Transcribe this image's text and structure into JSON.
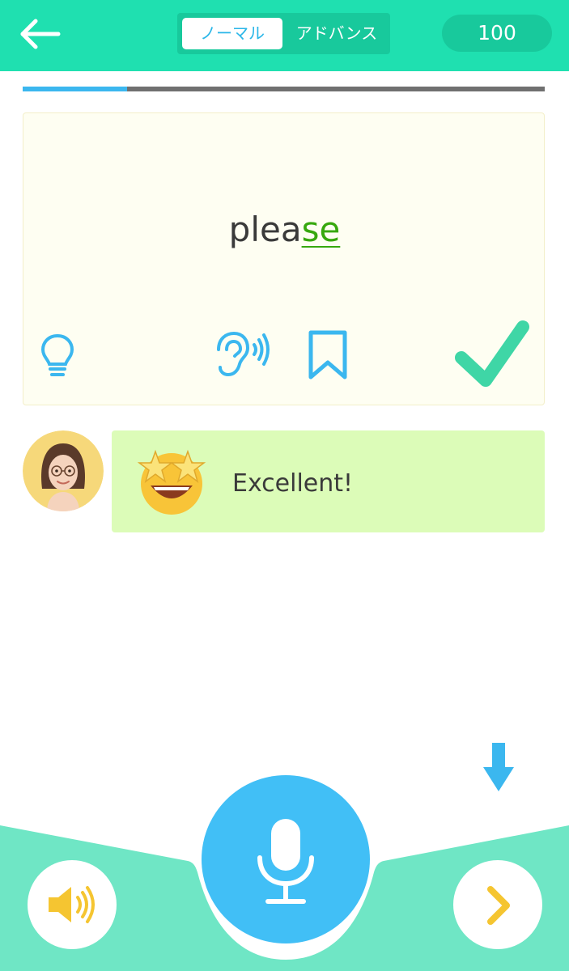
{
  "header": {
    "back_icon": "arrow-left-icon",
    "modes": [
      "ノーマル",
      "アドバンス"
    ],
    "active_mode": "ノーマル",
    "score": "100"
  },
  "progress": {
    "fraction": 0.2
  },
  "card": {
    "word_plain": "plea",
    "word_highlight": "se",
    "actions": [
      "lightbulb-icon",
      "ear-sound-icon",
      "bookmark-icon",
      "checkmark-icon"
    ]
  },
  "feedback": {
    "avatar": "teacher-avatar",
    "emoji": "star-struck-emoji",
    "message": "Excellent!"
  },
  "bottom": {
    "speaker_icon": "speaker-icon",
    "mic_icon": "microphone-icon",
    "next_icon": "chevron-right-icon",
    "hint_icon": "arrow-down-icon"
  },
  "colors": {
    "header": "#1fe0b0",
    "accent_blue": "#3bb7ef",
    "check_green": "#3fd6a6",
    "bubble": "#dcfcb8",
    "highlight": "#37a80e",
    "icon_yellow": "#f5c531"
  }
}
